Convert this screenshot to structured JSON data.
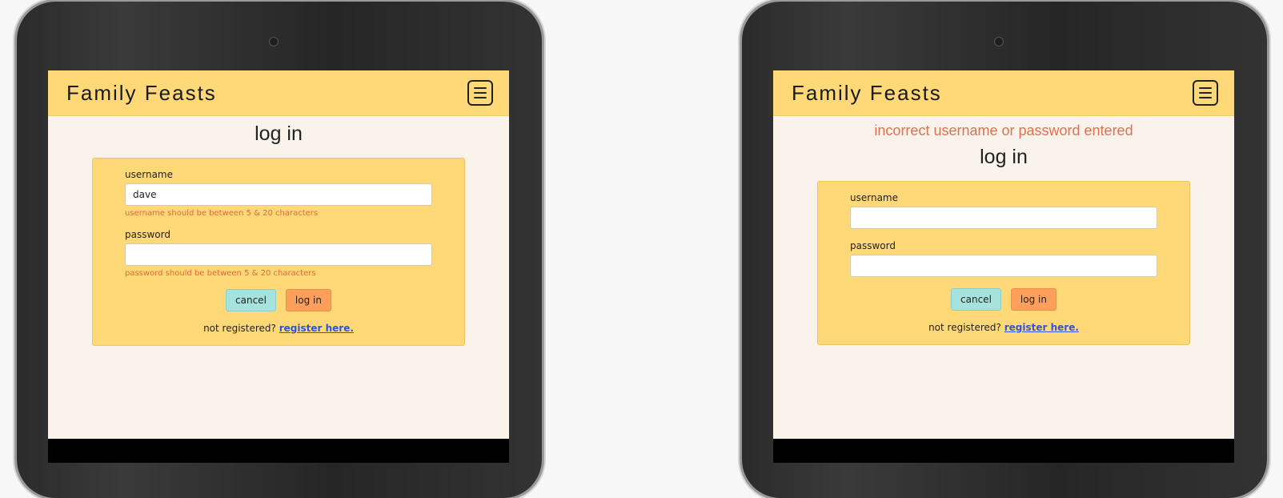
{
  "left_tablet": {
    "brand": "Family Feasts",
    "title": "log in",
    "username": {
      "label": "username",
      "value": "dave",
      "error": "username should be between 5 & 20 characters"
    },
    "password": {
      "label": "password",
      "value": "",
      "error": "password should be between 5 & 20 characters"
    },
    "cancel_label": "cancel",
    "login_label": "log in",
    "register_prompt": "not registered?",
    "register_link": "register here."
  },
  "right_tablet": {
    "brand": "Family Feasts",
    "error_banner": "incorrect username or password entered",
    "title": "log in",
    "username": {
      "label": "username",
      "value": ""
    },
    "password": {
      "label": "password",
      "value": ""
    },
    "cancel_label": "cancel",
    "login_label": "log in",
    "register_prompt": "not registered?",
    "register_link": "register here."
  },
  "icons": {
    "menu": "hamburger-menu-icon",
    "camera": "camera-icon"
  },
  "colors": {
    "navbar": "#ffd978",
    "card": "#ffd978",
    "page_bg": "#faf3ec",
    "error_text": "#e0704f",
    "cancel_button": "#a6e3dc",
    "login_button": "#ff9f5a",
    "link": "#2f54d6"
  }
}
